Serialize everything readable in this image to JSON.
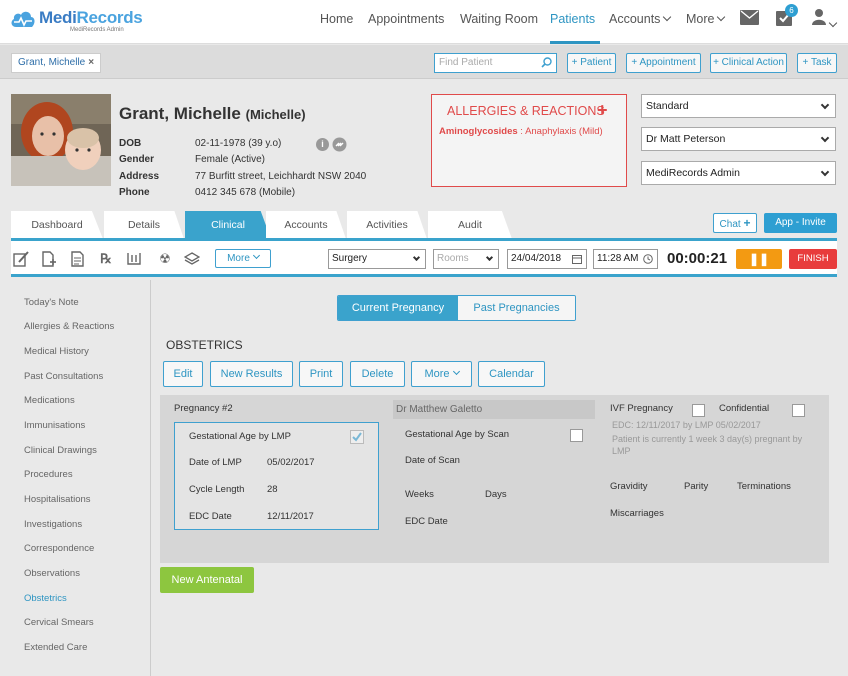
{
  "brand": {
    "name_a": "Medi",
    "name_b": "Records",
    "tagline": "MediRecords Admin"
  },
  "nav": {
    "items": [
      "Home",
      "Appointments",
      "Waiting Room",
      "Patients",
      "Accounts",
      "More"
    ],
    "badge_count": "6"
  },
  "patient_tab": {
    "label": "Grant, Michelle",
    "close": "×"
  },
  "search": {
    "placeholder": "Find Patient"
  },
  "quick_actions": [
    "+ Patient",
    "+ Appointment",
    "+ Clinical Action",
    "+ Task"
  ],
  "patient": {
    "name": "Grant, Michelle",
    "preferred": "(Michelle)",
    "details": [
      {
        "label": "DOB",
        "value": "02-11-1978 (39 y.o)"
      },
      {
        "label": "Gender",
        "value": "Female (Active)"
      },
      {
        "label": "Address",
        "value": "77 Burfitt street, Leichhardt NSW 2040"
      },
      {
        "label": "Phone",
        "value": "0412 345 678 (Mobile)"
      }
    ]
  },
  "allergies": {
    "title": "ALLERGIES & REACTIONS",
    "add": "+",
    "item_name": "Aminoglycosides",
    "item_reaction": " : Anaphylaxis (Mild)"
  },
  "header_selects": [
    "Standard",
    "Dr Matt Peterson",
    "MediRecords Admin"
  ],
  "main_tabs": [
    "Dashboard",
    "Details",
    "Clinical",
    "Accounts",
    "Activities",
    "Audit"
  ],
  "chat": {
    "label": "Chat",
    "plus": "+"
  },
  "app_invite": "App - Invite",
  "toolbar": {
    "more": "More",
    "location": "Surgery",
    "rooms": "Rooms",
    "date": "24/04/2018",
    "time": "11:28 AM",
    "timer": "00:00:21",
    "pause": "❚❚",
    "finish": "FINISH"
  },
  "sidebar": {
    "items": [
      "Today's Note",
      "Allergies & Reactions",
      "Medical History",
      "Past Consultations",
      "Medications",
      "Immunisations",
      "Clinical Drawings",
      "Procedures",
      "Hospitalisations",
      "Investigations",
      "Correspondence",
      "Observations",
      "Obstetrics",
      "Cervical Smears",
      "Extended Care"
    ],
    "active": "Obstetrics"
  },
  "pregnancy_tabs": {
    "current": "Current Pregnancy",
    "past": "Past Pregnancies"
  },
  "obstetrics": {
    "title": "OBSTETRICS",
    "buttons": {
      "edit": "Edit",
      "new_results": "New Results",
      "print": "Print",
      "delete": "Delete",
      "more": "More",
      "calendar": "Calendar"
    },
    "pregnancy_label": "Pregnancy #2",
    "lmp": {
      "gestational_age_label": "Gestational Age by LMP",
      "date_of_lmp_label": "Date of LMP",
      "date_of_lmp": "05/02/2017",
      "cycle_length_label": "Cycle Length",
      "cycle_length": "28",
      "edc_label": "EDC Date",
      "edc": "12/11/2017",
      "checked": true
    },
    "doctor": "Dr Matthew Galetto",
    "scan": {
      "gestational_age_label": "Gestational Age by Scan",
      "date_of_scan_label": "Date of Scan",
      "weeks_label": "Weeks",
      "days_label": "Days",
      "edc_label": "EDC Date"
    },
    "ivf_label": "IVF Pregnancy",
    "confidential_label": "Confidential",
    "edc_note": "EDC: 12/11/2017 by LMP 05/02/2017",
    "status_note": "Patient is currently 1 week 3 day(s) pregnant by LMP",
    "gravidity_label": "Gravidity",
    "parity_label": "Parity",
    "terminations_label": "Terminations",
    "miscarriages_label": "Miscarriages",
    "new_antenatal": "New Antenatal"
  }
}
